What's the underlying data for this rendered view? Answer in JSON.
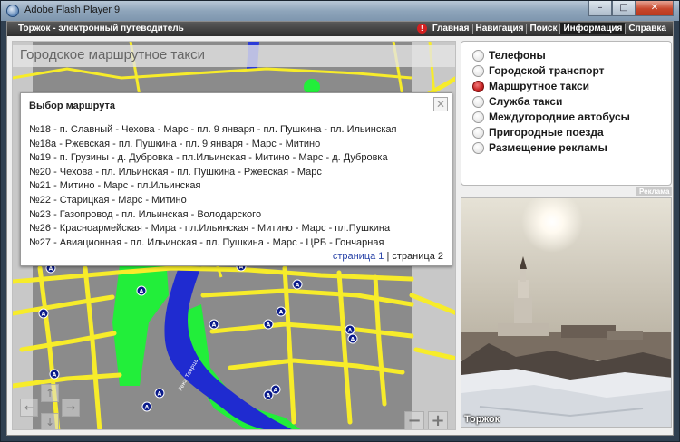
{
  "window": {
    "title": "Adobe Flash Player 9",
    "buttons": {
      "min": "–",
      "max": "□",
      "close": "✕"
    }
  },
  "header": {
    "site_title": "Торжок - электронный путеводитель",
    "nav": [
      {
        "label": "Главная",
        "active": false
      },
      {
        "label": "Навигация",
        "active": false
      },
      {
        "label": "Поиск",
        "active": false
      },
      {
        "label": "Информация",
        "active": true
      },
      {
        "label": "Справка",
        "active": false
      }
    ]
  },
  "map": {
    "heading": "Городское маршрутное такси",
    "stop_marker": "A",
    "river_label": "Река Тверца",
    "pan": {
      "up": "↑",
      "down": "↓",
      "left": "←",
      "right": "→"
    },
    "zoom": {
      "out": "−",
      "in": "+"
    }
  },
  "route_dialog": {
    "title": "Выбор маршрута",
    "close": "✕",
    "routes": [
      "№18 - п. Славный - Чехова - Марс - пл. 9 января - пл. Пушкина - пл. Ильинская",
      "№18а - Ржевская - пл. Пушкина - пл. 9 января - Марс - Митино",
      "№19 - п. Грузины - д. Дубровка - пл.Ильинская - Митино - Марс - д. Дубровка",
      "№20 - Чехова - пл. Ильинская - пл. Пушкина - Ржевская - Марс",
      "№21 - Митино - Марс - пл.Ильинская",
      "№22 - Старицкая - Марс - Митино",
      "№23 - Газопровод - пл. Ильинская - Володарского",
      "№26 - Красноармейская - Мира - пл.Ильинская - Митино - Марс - пл.Пушкина",
      "№27 - Авиационная - пл. Ильинская - пл. Пушкина - Марс - ЦРБ - Гончарная"
    ],
    "pager": {
      "page1": "страница 1",
      "separator": " | ",
      "page2": "страница 2"
    }
  },
  "menu": [
    {
      "label": "Телефоны",
      "selected": false
    },
    {
      "label": "Городской транспорт",
      "selected": false
    },
    {
      "label": "Маршрутное такси",
      "selected": true
    },
    {
      "label": "Служба такси",
      "selected": false
    },
    {
      "label": "Междугородние автобусы",
      "selected": false
    },
    {
      "label": "Пригородные поезда",
      "selected": false
    },
    {
      "label": "Размещение рекламы",
      "selected": false
    }
  ],
  "ad_label": "Реклама",
  "photo": {
    "caption": "Торжок"
  },
  "colors": {
    "road": "#f7ec2a",
    "river": "#1f2bd0",
    "park": "#22ee3a",
    "ground": "#8b8b8b",
    "accent_red": "#c42020"
  }
}
